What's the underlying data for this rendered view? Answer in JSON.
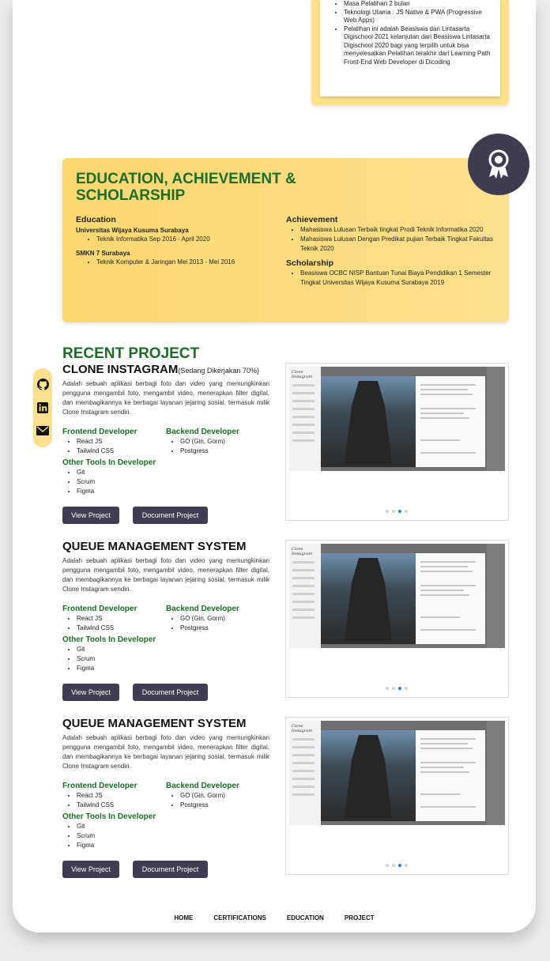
{
  "certification_card": {
    "items": [
      "Masa Pelatihan 2 bulan",
      "Teknologi Utama : JS Native & PWA (Progressive Web Apps)",
      "Pelatihan ini adalah Beasiswa dari Lintasarta Digischool 2021 kelanjutan dari Beasiswa Lintasarta Digischool 2020 bagi yang terpilih untuk bisa menyelesaikan Pelatihan terakhir dari Learning Path Front-End Web Developer di Dicoding"
    ]
  },
  "education_section": {
    "title": "EDUCATION, ACHIEVEMENT & SCHOLARSHIP",
    "education_heading": "Education",
    "school1_name": "Universitas Wijaya Kusuma Surabaya",
    "school1_detail": "Teknik Informatika Sep 2016 - April 2020",
    "school2_name": "SMKN 7 Surabaya",
    "school2_detail": "Teknik Komputer & Jaringan Mei 2013 - Mei 2016",
    "achievement_heading": "Achievement",
    "achievements": [
      "Mahasiswa Lulusan Terbaik tingkat Prodi Teknik Informatika 2020",
      "Mahasiswa Lulusan Dengan Predikat pujian Terbaik Tingkat Fakultas Teknik 2020"
    ],
    "scholarship_heading": "Scholarship",
    "scholarships": [
      "Beasiswa OCBC NISP Bantuan Tunai Biaya Pendidikan 1 Semester Tingkat Universitas Wijaya Kusuma Surabaya 2019"
    ]
  },
  "recent_project": {
    "title": "RECENT PROJECT",
    "projects": [
      {
        "name": "CLONE INSTAGRAM",
        "status": "(Sedang Dikerjakan 70%)",
        "description": "Adalah sebuah aplikasi berbagi foto dan video yang memungkinkan pengguna mengambil foto, mengambil video, menerapkan filter digital, dan membagikannya ke berbagai layanan jejaring sosial, termasuk milik Clone Instagram sendiri.",
        "frontend_label": "Frontend Developer",
        "frontend": [
          "React JS",
          "Tailwind CSS"
        ],
        "backend_label": "Backend Developer",
        "backend": [
          "GO (Gin, Gorm)",
          "Postgress"
        ],
        "tools_label": "Other Tools In Developer",
        "tools": [
          "Git",
          "Scrum",
          "Figma"
        ],
        "view_label": "View Project",
        "doc_label": "Document Project"
      },
      {
        "name": "QUEUE MANAGEMENT SYSTEM",
        "status": "",
        "description": "Adalah sebuah aplikasi berbagi foto dan video yang memungkinkan pengguna mengambil foto, mengambil video, menerapkan filter digital, dan membagikannya ke berbagai layanan jejaring sosial, termasuk milik Clone Instagram sendiri.",
        "frontend_label": "Frontend Developer",
        "frontend": [
          "React JS",
          "Tailwind CSS"
        ],
        "backend_label": "Backend Developer",
        "backend": [
          "GO (Gin, Gorm)",
          "Postgress"
        ],
        "tools_label": "Other Tools In Developer",
        "tools": [
          "Git",
          "Scrum",
          "Figma"
        ],
        "view_label": "View Project",
        "doc_label": "Document Project"
      },
      {
        "name": "QUEUE MANAGEMENT SYSTEM",
        "status": "",
        "description": "Adalah sebuah aplikasi berbagi foto dan video yang memungkinkan pengguna mengambil foto, mengambil video, menerapkan filter digital, dan membagikannya ke berbagai layanan jejaring sosial, termasuk milik Clone Instagram sendiri.",
        "frontend_label": "Frontend Developer",
        "frontend": [
          "React JS",
          "Tailwind CSS"
        ],
        "backend_label": "Backend Developer",
        "backend": [
          "GO (Gin, Gorm)",
          "Postgress"
        ],
        "tools_label": "Other Tools In Developer",
        "tools": [
          "Git",
          "Scrum",
          "Figma"
        ],
        "view_label": "View Project",
        "doc_label": "Document Project"
      }
    ]
  },
  "social": [
    "github-icon",
    "linkedin-icon",
    "mail-icon"
  ],
  "footer": {
    "links": [
      "HOME",
      "CERTIFICATIONS",
      "EDUCATION",
      "PROJECT"
    ]
  },
  "colors": {
    "accent_green": "#1e6b2a",
    "card_yellow": "#fde08e",
    "button_dark": "#3f3b50",
    "carousel_active": "#2c7be5"
  }
}
